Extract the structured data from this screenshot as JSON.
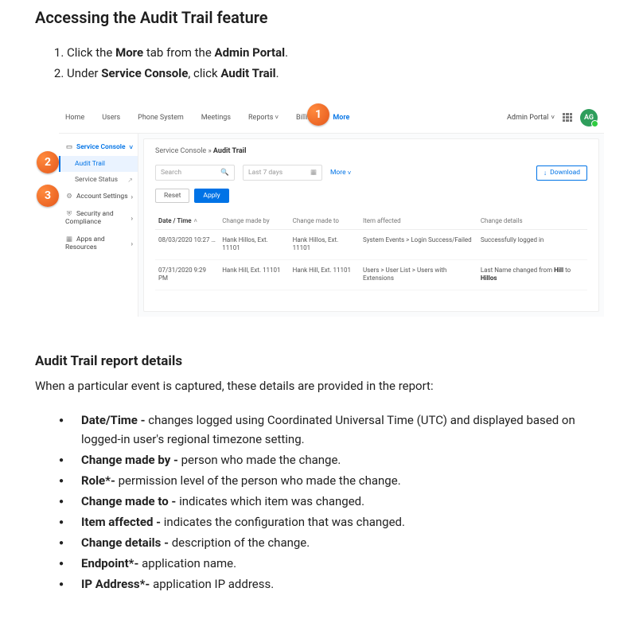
{
  "section_title": "Accessing the Audit Trail feature",
  "steps": {
    "s1": {
      "pre": "Click the ",
      "b1": "More",
      "mid": " tab from the ",
      "b2": "Admin Portal",
      "post": "."
    },
    "s2": {
      "pre": "Under ",
      "b1": "Service Console",
      "mid": ", click ",
      "b2": "Audit Trail",
      "post": "."
    }
  },
  "callouts": {
    "c1": "1",
    "c2": "2",
    "c3": "3"
  },
  "topnav": {
    "items": [
      "Home",
      "Users",
      "Phone System",
      "Meetings",
      "Reports",
      "Billing",
      "More"
    ],
    "portal_label": "Admin Portal",
    "avatar": "AG"
  },
  "sidebar": {
    "header": "Service Console",
    "items": {
      "audit_trail": "Audit Trail",
      "service_status": "Service Status",
      "account_settings": "Account Settings",
      "security": "Security and Compliance",
      "apps": "Apps and Resources"
    }
  },
  "main": {
    "breadcrumb_root": "Service Console",
    "breadcrumb_sep": " » ",
    "breadcrumb_cur": "Audit Trail",
    "search_placeholder": "Search",
    "date_range": "Last 7 days",
    "more_label": "More",
    "download_label": "Download",
    "reset_label": "Reset",
    "apply_label": "Apply",
    "columns": {
      "datetime": "Date / Time",
      "by": "Change made by",
      "to": "Change made to",
      "item": "Item affected",
      "details": "Change details"
    },
    "rows": [
      {
        "datetime": "08/03/2020 10:27 …",
        "by": "Hank Hillos, Ext. 11101",
        "to": "Hank Hillos, Ext. 11101",
        "item": "System Events > Login Success/Failed",
        "details_plain": "Successfully logged in"
      },
      {
        "datetime": "07/31/2020 9:29 PM",
        "by": "Hank Hill, Ext. 11101",
        "to": "Hank Hill, Ext. 11101",
        "item": "Users > User List > Users with Extensions",
        "details_pre": "Last Name changed from ",
        "details_b1": "Hill",
        "details_mid": " to ",
        "details_b2": "Hillos"
      }
    ]
  },
  "sub_title": "Audit Trail report details",
  "intro": "When a particular event is captured, these details are provided in the report:",
  "details": [
    {
      "term": "Date/Time - ",
      "desc": "changes logged using Coordinated Universal Time (UTC) and displayed based on logged-in user's regional timezone setting."
    },
    {
      "term": "Change made by - ",
      "desc": "person who made the change."
    },
    {
      "term": "Role*- ",
      "desc": "permission level of the person who made the change."
    },
    {
      "term": "Change made to - ",
      "desc": "indicates which item was changed."
    },
    {
      "term": "Item affected - ",
      "desc": "indicates the configuration that was changed."
    },
    {
      "term": "Change details - ",
      "desc": "description of the change."
    },
    {
      "term": "Endpoint*- ",
      "desc": "application name."
    },
    {
      "term": "IP Address*- ",
      "desc": "application IP address."
    }
  ]
}
